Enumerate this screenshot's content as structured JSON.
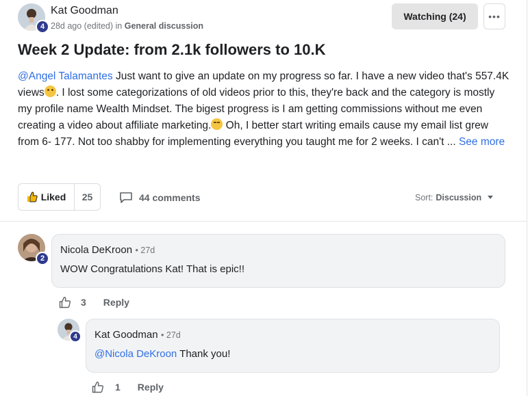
{
  "post": {
    "author": "Kat Goodman",
    "author_level": "4",
    "meta_time": "28d ago (edited) in ",
    "category": "General discussion",
    "watch_label": "Watching (24)",
    "more_label": "•••",
    "title": "Week 2 Update: from 2.1k followers to 10.K",
    "body_mention": "@Angel Talamantes",
    "body_part1": " Just want to give an update on my progress so far. I have a new video that's 557.4K views",
    "body_part2": ". I lost some categorizations of old videos prior to this, they're back and the category is mostly my profile name Wealth Mindset. The bigest progress is I am getting commissions without me even creating a video about affiliate marketing.",
    "body_part3": " Oh, I better start writing emails cause my email list grew from 6- 177. Not too shabby for implementing everything you taught me for 2 weeks. I can't ... ",
    "see_more": "See more",
    "emoji1": "flushed-face",
    "emoji2": "grinning-squinting-face",
    "liked_label": "Liked",
    "like_count": "25",
    "comments_label": "44 comments",
    "sort_label": "Sort:",
    "sort_value": "Discussion"
  },
  "comments": [
    {
      "author": "Nicola DeKroon",
      "level": "2",
      "time": "27d",
      "text": "WOW Congratulations Kat! That is epic!!",
      "likes": "3",
      "reply_label": "Reply"
    }
  ],
  "reply": {
    "author": "Kat Goodman",
    "level": "4",
    "time": "27d",
    "mention": "@Nicola DeKroon",
    "text": " Thank you!",
    "likes": "1",
    "reply_label": "Reply"
  },
  "colors": {
    "accent_link": "#2f6fe4",
    "badge": "#2e3a8c",
    "watch_bg": "#e4e4e4",
    "bubble_bg": "#f1f3f5"
  },
  "icons": {
    "like": "thumbs-up-icon",
    "comment": "comment-bubble-icon",
    "sort": "caret-down-icon",
    "more": "more-dots-icon"
  }
}
